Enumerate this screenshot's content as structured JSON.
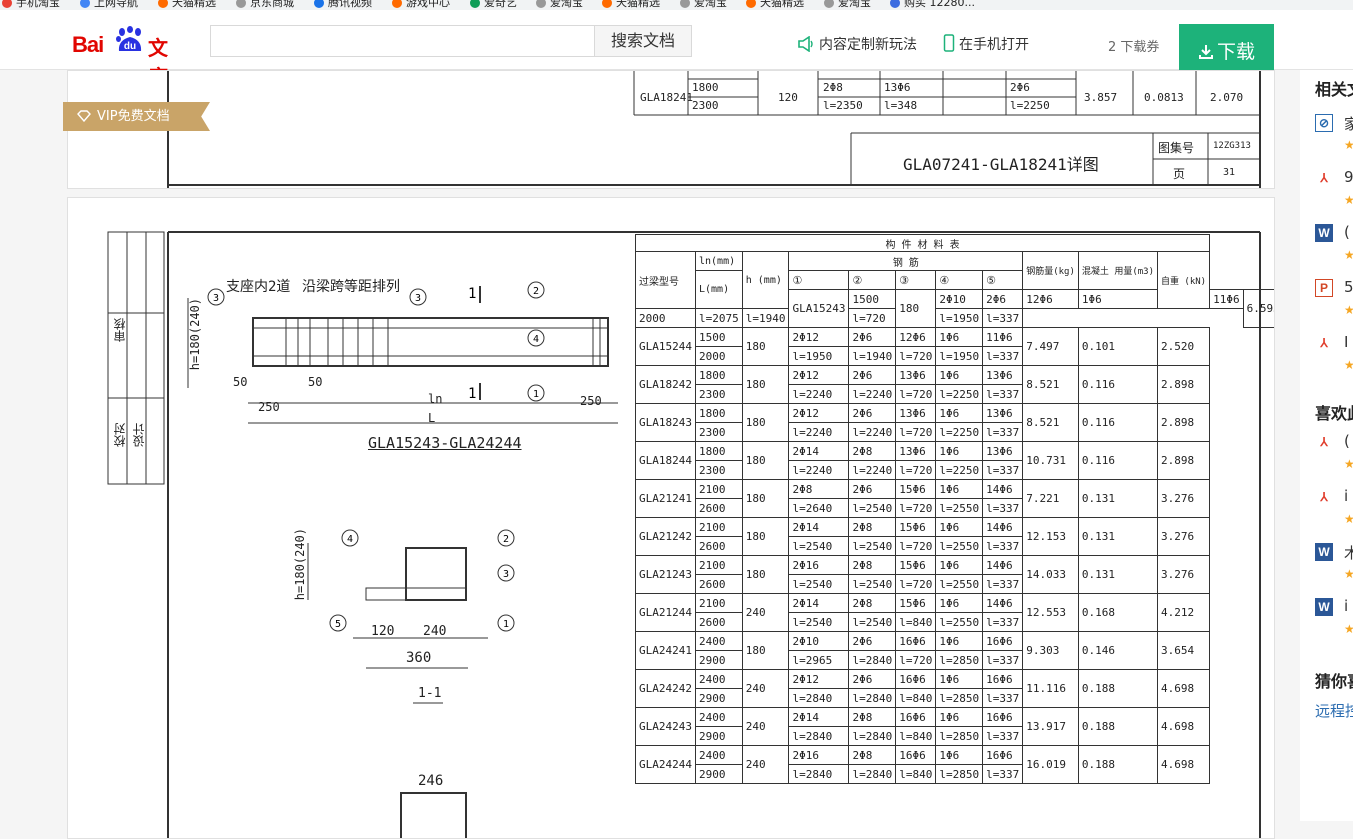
{
  "bookmarks": [
    "手机淘宝",
    "上网导航",
    "天猫精选",
    "京东商城",
    "腾讯视频",
    "游戏中心",
    "爱奇艺",
    "爱淘宝",
    "天猫精选",
    "爱淘宝",
    "天猫精选",
    "爱淘宝",
    "购买 12280..."
  ],
  "header": {
    "logo_bai": "Bai",
    "logo_du": "du",
    "logo_wenku": "文库",
    "search_placeholder": "",
    "search_button": "搜索文档",
    "custom_link": "内容定制新玩法",
    "phone_link": "在手机打开",
    "coupon": "2 下载券",
    "download": "下载"
  },
  "vip_badge": "VIP免费文档",
  "page1": {
    "top_rows": [
      {
        "code": "",
        "l1": "2000",
        "h": "",
        "c1": "l=1950",
        "c2": "l=348",
        "c3": "",
        "c4": "l=1950"
      },
      {
        "code": "GLA18241",
        "l1": "1800",
        "l2": "2300",
        "h": "120",
        "a": "2Φ8",
        "b": "13Φ6",
        "c": "2Φ6",
        "d": "l=2350",
        "e": "l=348",
        "f": "l=2250",
        "weight": "3.857",
        "conc": "0.0813",
        "self": "2.070"
      }
    ],
    "title_block": "GLA07241-GLA18241详图",
    "atlas_label": "图集号",
    "atlas_no": "12ZG313",
    "page_label": "页",
    "page_no": "31"
  },
  "page2": {
    "side_labels": [
      "审核",
      "校对",
      "设计"
    ],
    "drawing_title_left": "GLA15243-GLA24244",
    "note_1": "支座内2道",
    "note_2": "沿梁跨等距排列",
    "section_label": "1-1",
    "dims": [
      "250",
      "50",
      "50",
      "250",
      "ln",
      "L",
      "h=180(240)",
      "120",
      "240",
      "360",
      "246"
    ],
    "table_title": "构 件 材 料 表",
    "headers": {
      "code": "过梁型号",
      "ln": "ln(mm)",
      "L": "L(mm)",
      "h": "h (mm)",
      "rebar": "钢 筋",
      "cols": [
        "①",
        "②",
        "③",
        "④",
        "⑤"
      ],
      "weight": "钢筋量(kg)",
      "concrete": "混凝土 用量(m3)",
      "self": "自重 (kN)"
    },
    "rows": [
      {
        "code": "GLA15243",
        "ln": "1500",
        "L": "2000",
        "h": "180",
        "r1": "2Φ10",
        "r1l": "l=2075",
        "r2": "2Φ6",
        "r2l": "l=1940",
        "r3": "12Φ6",
        "r3l": "l=720",
        "r4": "1Φ6",
        "r4l": "l=1950",
        "r5": "11Φ6",
        "r5l": "l=337",
        "w": "6.593",
        "c": "0.101",
        "s": "2.520"
      },
      {
        "code": "GLA15244",
        "ln": "1500",
        "L": "2000",
        "h": "180",
        "r1": "2Φ12",
        "r1l": "l=1950",
        "r2": "2Φ6",
        "r2l": "l=1940",
        "r3": "12Φ6",
        "r3l": "l=720",
        "r4": "1Φ6",
        "r4l": "l=1950",
        "r5": "11Φ6",
        "r5l": "l=337",
        "w": "7.497",
        "c": "0.101",
        "s": "2.520"
      },
      {
        "code": "GLA18242",
        "ln": "1800",
        "L": "2300",
        "h": "180",
        "r1": "2Φ12",
        "r1l": "l=2240",
        "r2": "2Φ6",
        "r2l": "l=2240",
        "r3": "13Φ6",
        "r3l": "l=720",
        "r4": "1Φ6",
        "r4l": "l=2250",
        "r5": "13Φ6",
        "r5l": "l=337",
        "w": "8.521",
        "c": "0.116",
        "s": "2.898"
      },
      {
        "code": "GLA18243",
        "ln": "1800",
        "L": "2300",
        "h": "180",
        "r1": "2Φ12",
        "r1l": "l=2240",
        "r2": "2Φ6",
        "r2l": "l=2240",
        "r3": "13Φ6",
        "r3l": "l=720",
        "r4": "1Φ6",
        "r4l": "l=2250",
        "r5": "13Φ6",
        "r5l": "l=337",
        "w": "8.521",
        "c": "0.116",
        "s": "2.898"
      },
      {
        "code": "GLA18244",
        "ln": "1800",
        "L": "2300",
        "h": "180",
        "r1": "2Φ14",
        "r1l": "l=2240",
        "r2": "2Φ8",
        "r2l": "l=2240",
        "r3": "13Φ6",
        "r3l": "l=720",
        "r4": "1Φ6",
        "r4l": "l=2250",
        "r5": "13Φ6",
        "r5l": "l=337",
        "w": "10.731",
        "c": "0.116",
        "s": "2.898"
      },
      {
        "code": "GLA21241",
        "ln": "2100",
        "L": "2600",
        "h": "180",
        "r1": "2Φ8",
        "r1l": "l=2640",
        "r2": "2Φ6",
        "r2l": "l=2540",
        "r3": "15Φ6",
        "r3l": "l=720",
        "r4": "1Φ6",
        "r4l": "l=2550",
        "r5": "14Φ6",
        "r5l": "l=337",
        "w": "7.221",
        "c": "0.131",
        "s": "3.276"
      },
      {
        "code": "GLA21242",
        "ln": "2100",
        "L": "2600",
        "h": "180",
        "r1": "2Φ14",
        "r1l": "l=2540",
        "r2": "2Φ8",
        "r2l": "l=2540",
        "r3": "15Φ6",
        "r3l": "l=720",
        "r4": "1Φ6",
        "r4l": "l=2550",
        "r5": "14Φ6",
        "r5l": "l=337",
        "w": "12.153",
        "c": "0.131",
        "s": "3.276"
      },
      {
        "code": "GLA21243",
        "ln": "2100",
        "L": "2600",
        "h": "180",
        "r1": "2Φ16",
        "r1l": "l=2540",
        "r2": "2Φ8",
        "r2l": "l=2540",
        "r3": "15Φ6",
        "r3l": "l=720",
        "r4": "1Φ6",
        "r4l": "l=2550",
        "r5": "14Φ6",
        "r5l": "l=337",
        "w": "14.033",
        "c": "0.131",
        "s": "3.276"
      },
      {
        "code": "GLA21244",
        "ln": "2100",
        "L": "2600",
        "h": "240",
        "r1": "2Φ14",
        "r1l": "l=2540",
        "r2": "2Φ8",
        "r2l": "l=2540",
        "r3": "15Φ6",
        "r3l": "l=840",
        "r4": "1Φ6",
        "r4l": "l=2550",
        "r5": "14Φ6",
        "r5l": "l=337",
        "w": "12.553",
        "c": "0.168",
        "s": "4.212"
      },
      {
        "code": "GLA24241",
        "ln": "2400",
        "L": "2900",
        "h": "180",
        "r1": "2Φ10",
        "r1l": "l=2965",
        "r2": "2Φ6",
        "r2l": "l=2840",
        "r3": "16Φ6",
        "r3l": "l=720",
        "r4": "1Φ6",
        "r4l": "l=2850",
        "r5": "16Φ6",
        "r5l": "l=337",
        "w": "9.303",
        "c": "0.146",
        "s": "3.654"
      },
      {
        "code": "GLA24242",
        "ln": "2400",
        "L": "2900",
        "h": "240",
        "r1": "2Φ12",
        "r1l": "l=2840",
        "r2": "2Φ6",
        "r2l": "l=2840",
        "r3": "16Φ6",
        "r3l": "l=840",
        "r4": "1Φ6",
        "r4l": "l=2850",
        "r5": "16Φ6",
        "r5l": "l=337",
        "w": "11.116",
        "c": "0.188",
        "s": "4.698"
      },
      {
        "code": "GLA24243",
        "ln": "2400",
        "L": "2900",
        "h": "240",
        "r1": "2Φ14",
        "r1l": "l=2840",
        "r2": "2Φ8",
        "r2l": "l=2840",
        "r3": "16Φ6",
        "r3l": "l=840",
        "r4": "1Φ6",
        "r4l": "l=2850",
        "r5": "16Φ6",
        "r5l": "l=337",
        "w": "13.917",
        "c": "0.188",
        "s": "4.698"
      },
      {
        "code": "GLA24244",
        "ln": "2400",
        "L": "2900",
        "h": "240",
        "r1": "2Φ16",
        "r1l": "l=2840",
        "r2": "2Φ8",
        "r2l": "l=2840",
        "r3": "16Φ6",
        "r3l": "l=840",
        "r4": "1Φ6",
        "r4l": "l=2850",
        "r5": "16Φ6",
        "r5l": "l=337",
        "w": "16.019",
        "c": "0.188",
        "s": "4.698"
      }
    ]
  },
  "sidebar": {
    "related_title": "相关文",
    "related_items": [
      {
        "icon": "link-icon",
        "text": "家",
        "star": "★"
      },
      {
        "icon": "pdf-icon",
        "text": "9",
        "star": "★"
      },
      {
        "icon": "word-icon",
        "text": "(",
        "star": "★"
      },
      {
        "icon": "ppt-icon",
        "text": "5",
        "star": "★"
      },
      {
        "icon": "pdf-icon",
        "text": "I",
        "star": "★"
      }
    ],
    "like_title": "喜欢此",
    "like_items": [
      {
        "icon": "pdf-icon",
        "text": "(",
        "star": "★"
      },
      {
        "icon": "pdf-icon",
        "text": "i",
        "star": "★"
      },
      {
        "icon": "word-icon",
        "text": "木",
        "star": "★"
      },
      {
        "icon": "word-icon",
        "text": "i",
        "star": "★"
      }
    ],
    "guess_title": "猜你喜",
    "guess_link": "远程控"
  },
  "colors": {
    "brand_red": "#e10601",
    "brand_blue": "#2932e1",
    "download_green": "#1db27a",
    "vip_gold": "#c9a468",
    "star": "#f5a623"
  }
}
